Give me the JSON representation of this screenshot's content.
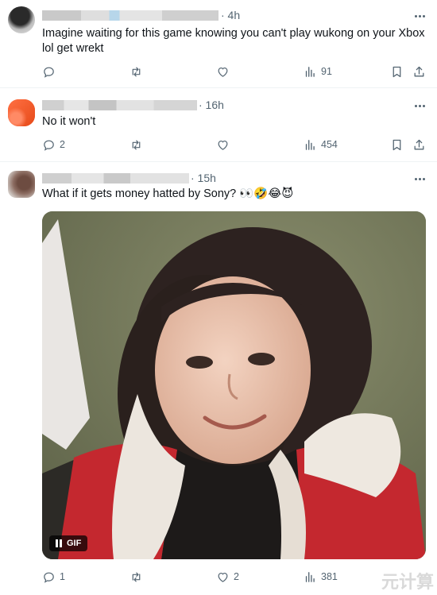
{
  "tweets": [
    {
      "time": "· 4h",
      "text_line1": "Imagine waiting for this game knowing you can't play wukong on your Xbox",
      "text_line2": "lol get wrekt",
      "reply_count": "",
      "retweet_count": "",
      "like_count": "",
      "views": "91"
    },
    {
      "time": "· 16h",
      "text_line1": "No it won't",
      "reply_count": "2",
      "retweet_count": "",
      "like_count": "",
      "views": "454"
    },
    {
      "time": "· 15h",
      "text_line1": "What if it gets money hatted by Sony? 👀🤣😂😈",
      "reply_count": "1",
      "retweet_count": "",
      "like_count": "2",
      "views": "381",
      "media": {
        "type": "GIF",
        "badge_label": "GIF"
      }
    }
  ],
  "icons": {
    "reply": "reply-icon",
    "retweet": "retweet-icon",
    "like": "heart-icon",
    "views": "views-icon",
    "bookmark": "bookmark-icon",
    "share": "share-icon",
    "more": "more-icon",
    "pause": "pause-icon"
  },
  "colors": {
    "text": "#0f1419",
    "secondary": "#536471",
    "divider": "#eff3f4",
    "avatar2": "#f4511e"
  },
  "watermark": "元计算"
}
